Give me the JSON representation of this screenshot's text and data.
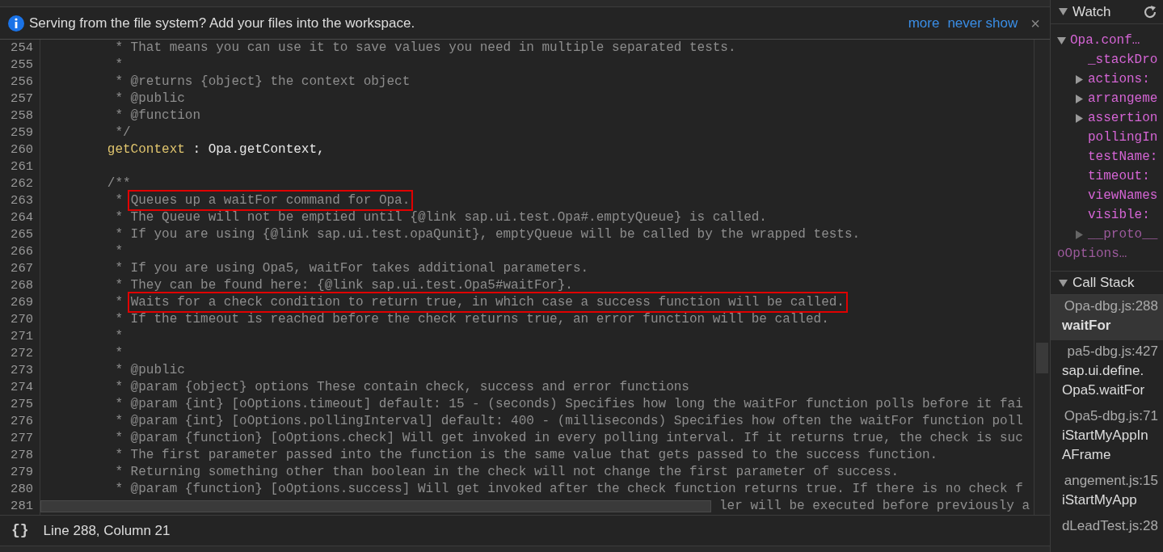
{
  "info_bar": {
    "message": "Serving from the file system? Add your files into the workspace.",
    "links": [
      "more",
      "never show"
    ],
    "close": "×"
  },
  "editor": {
    "lines": [
      {
        "number": "254",
        "kind": "comment",
        "text": " * That means you can use it to save values you need in multiple separated tests."
      },
      {
        "number": "255",
        "kind": "comment",
        "text": " *"
      },
      {
        "number": "256",
        "kind": "comment",
        "text": " * @returns {object} the context object"
      },
      {
        "number": "257",
        "kind": "comment",
        "text": " * @public"
      },
      {
        "number": "258",
        "kind": "comment",
        "text": " * @function"
      },
      {
        "number": "259",
        "kind": "comment",
        "text": " */"
      },
      {
        "number": "260",
        "kind": "code",
        "tokens": [
          {
            "kind": "name",
            "text": "getContext"
          },
          {
            "kind": "plain",
            "text": " : Opa.getContext,"
          }
        ]
      },
      {
        "number": "261",
        "kind": "blank"
      },
      {
        "number": "262",
        "kind": "comment",
        "text": "/**"
      },
      {
        "number": "263",
        "kind": "comment",
        "text": " * ",
        "boxed": "Queues up a waitFor command for Opa."
      },
      {
        "number": "264",
        "kind": "comment",
        "text": " * The Queue will not be emptied until {@link sap.ui.test.Opa#.emptyQueue} is called."
      },
      {
        "number": "265",
        "kind": "comment",
        "text": " * If you are using {@link sap.ui.test.opaQunit}, emptyQueue will be called by the wrapped tests."
      },
      {
        "number": "266",
        "kind": "comment",
        "text": " *"
      },
      {
        "number": "267",
        "kind": "comment",
        "text": " * If you are using Opa5, waitFor takes additional parameters."
      },
      {
        "number": "268",
        "kind": "comment",
        "text": " * They can be found here: {@link sap.ui.test.Opa5#waitFor}."
      },
      {
        "number": "269",
        "kind": "comment",
        "text": " * ",
        "boxed": "Waits for a check condition to return true, in which case a success function will be called."
      },
      {
        "number": "270",
        "kind": "comment",
        "text": " * If the timeout is reached before the check returns true, an error function will be called."
      },
      {
        "number": "271",
        "kind": "comment",
        "text": " *"
      },
      {
        "number": "272",
        "kind": "comment",
        "text": " *"
      },
      {
        "number": "273",
        "kind": "comment",
        "text": " * @public"
      },
      {
        "number": "274",
        "kind": "comment",
        "text": " * @param {object} options These contain check, success and error functions"
      },
      {
        "number": "275",
        "kind": "comment",
        "text": " * @param {int} [oOptions.timeout] default: 15 - (seconds) Specifies how long the waitFor function polls before it fai"
      },
      {
        "number": "276",
        "kind": "comment",
        "text": " * @param {int} [oOptions.pollingInterval] default: 400 - (milliseconds) Specifies how often the waitFor function poll"
      },
      {
        "number": "277",
        "kind": "comment",
        "text": " * @param {function} [oOptions.check] Will get invoked in every polling interval. If it returns true, the check is suc"
      },
      {
        "number": "278",
        "kind": "comment",
        "text": " * The first parameter passed into the function is the same value that gets passed to the success function."
      },
      {
        "number": "279",
        "kind": "comment",
        "text": " * Returning something other than boolean in the check will not change the first parameter of success."
      },
      {
        "number": "280",
        "kind": "comment",
        "text": " * @param {function} [oOptions.success] Will get invoked after the check function returns true. If there is no check f"
      },
      {
        "number": "281",
        "kind": "covered",
        "text": "ler will be executed before previously a"
      }
    ]
  },
  "status_bar": {
    "format_button": "{}",
    "position": "Line 288, Column 21"
  },
  "watch": {
    "title": "Watch",
    "expanded": true,
    "items": [
      {
        "label": "Opa.conf…",
        "expanded": true,
        "dimmed": false,
        "children": [
          {
            "label": "_stackDro",
            "dimmed": false
          },
          {
            "label": "actions:",
            "expanded": false,
            "dimmed": false
          },
          {
            "label": "arrangeme",
            "expanded": false,
            "dimmed": false
          },
          {
            "label": "assertion",
            "expanded": false,
            "dimmed": false
          },
          {
            "label": "pollingIn",
            "dimmed": false
          },
          {
            "label": "testName:",
            "dimmed": false
          },
          {
            "label": "timeout:",
            "dimmed": false
          },
          {
            "label": "viewNames",
            "dimmed": false
          },
          {
            "label": "visible:",
            "dimmed": false
          },
          {
            "label": "__proto__",
            "expanded": false,
            "dimmed": true
          }
        ]
      },
      {
        "label": "oOptions…",
        "dimmed": true
      }
    ]
  },
  "call_stack": {
    "title": "Call Stack",
    "expanded": true,
    "frames": [
      {
        "location": "Opa-dbg.js:288",
        "function": "waitFor",
        "selected": true
      },
      {
        "location": "pa5-dbg.js:427",
        "function": "sap.ui.define.Opa5.waitFor",
        "selected": false
      },
      {
        "location": "Opa5-dbg.js:71",
        "function": "iStartMyAppInAFrame",
        "selected": false
      },
      {
        "location": "angement.js:15",
        "function": "iStartMyApp",
        "selected": false
      },
      {
        "location": "dLeadTest.js:28",
        "selected": false
      }
    ]
  }
}
